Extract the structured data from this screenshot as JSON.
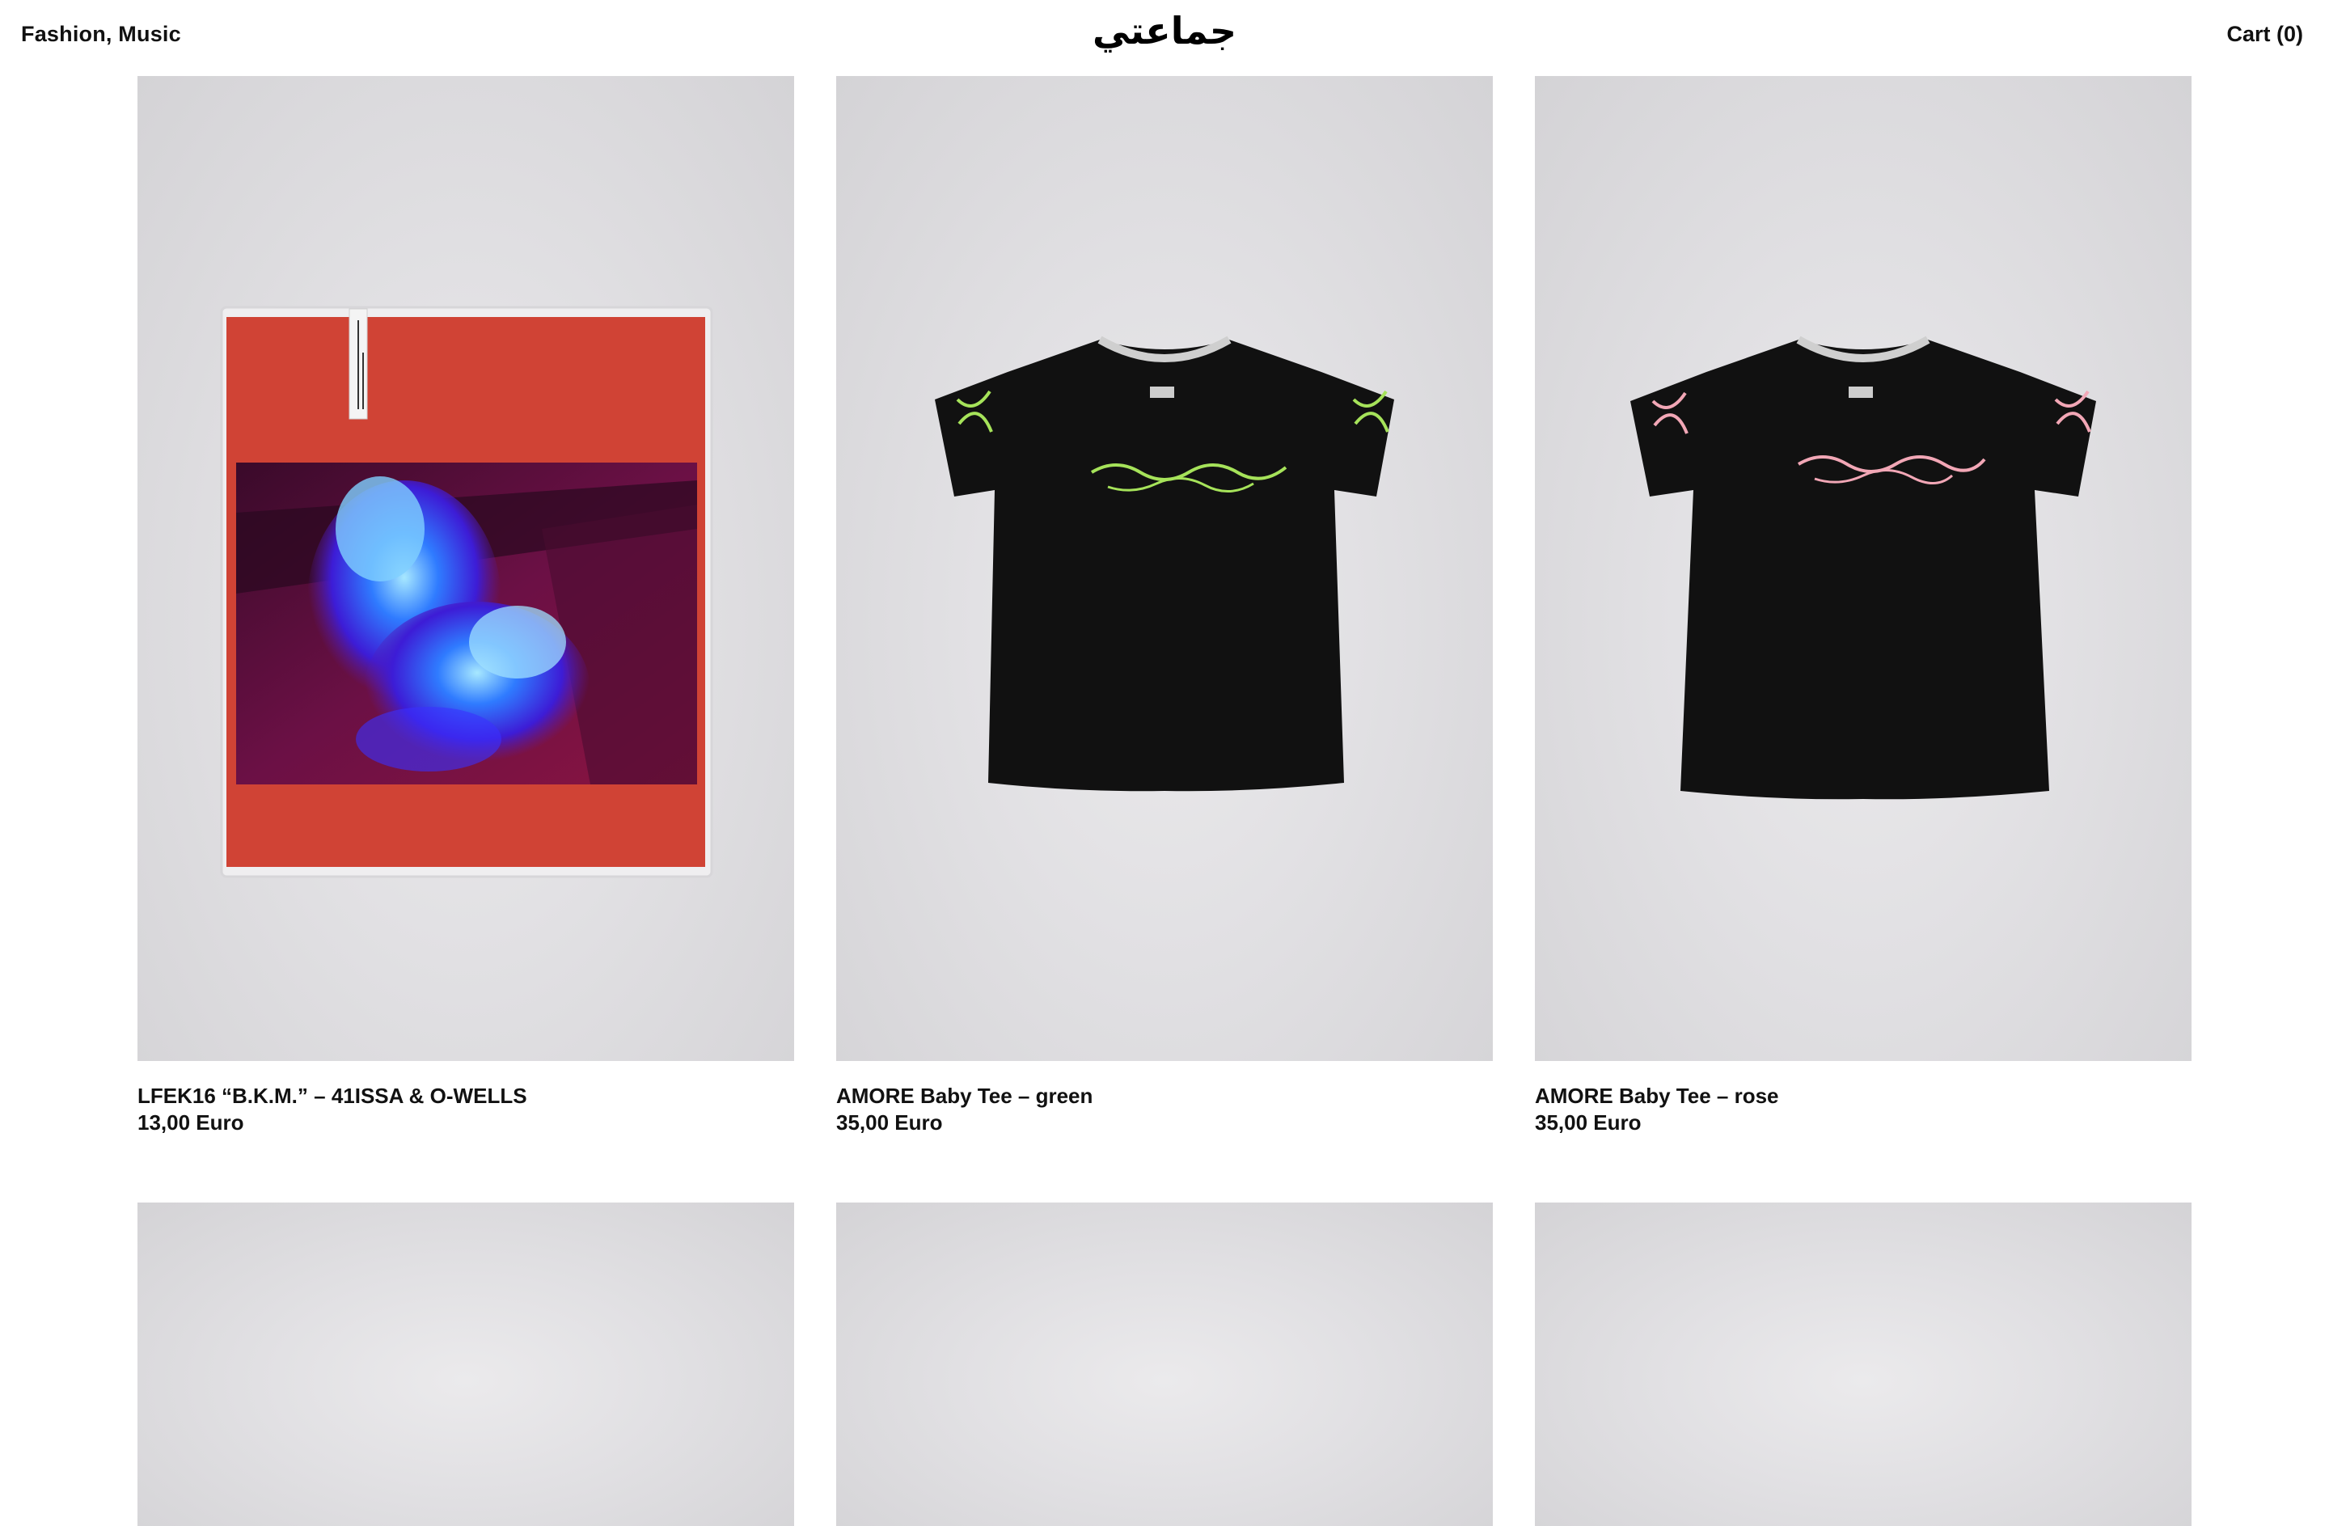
{
  "header": {
    "nav_label": "Fashion, Music",
    "logo_text": "جماعتي",
    "cart_label": "Cart (0)"
  },
  "products": [
    {
      "title": "LFEK16 “B.K.M.” – 41ISSA & O-WELLS",
      "price": "13,00 Euro",
      "image": "vinyl-record-sleeve-red"
    },
    {
      "title": "AMORE Baby Tee – green",
      "price": "35,00 Euro",
      "image": "black-tshirt-green-print",
      "print_color": "#a6e35a"
    },
    {
      "title": "AMORE Baby Tee – rose",
      "price": "35,00 Euro",
      "image": "black-tshirt-rose-print",
      "print_color": "#f2a7b6"
    }
  ],
  "colors": {
    "background": "#ffffff",
    "text": "#111111",
    "image_bg": "#e1e0e3",
    "sleeve_red": "#d04335"
  }
}
